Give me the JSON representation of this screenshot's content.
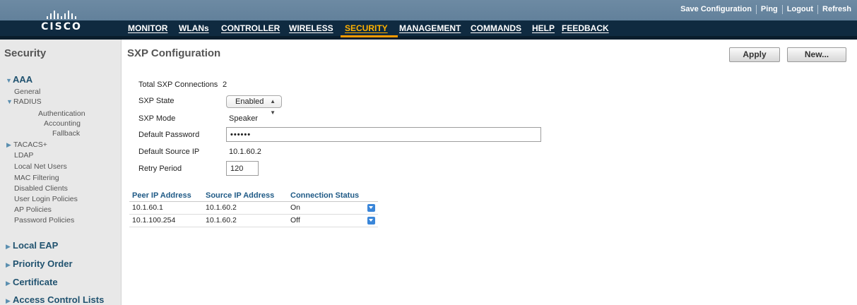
{
  "header": {
    "logo_text": "CISCO",
    "nav": [
      {
        "label": "MONITOR",
        "active": false
      },
      {
        "label": "WLANs",
        "active": false
      },
      {
        "label": "CONTROLLER",
        "active": false
      },
      {
        "label": "WIRELESS",
        "active": false
      },
      {
        "label": "SECURITY",
        "active": true
      },
      {
        "label": "MANAGEMENT",
        "active": false
      },
      {
        "label": "COMMANDS",
        "active": false
      },
      {
        "label": "HELP",
        "active": false
      },
      {
        "label": "FEEDBACK",
        "active": false
      }
    ],
    "utils": [
      "Save Configuration",
      "Ping",
      "Logout",
      "Refresh"
    ],
    "colors": {
      "active": "#ffb100",
      "bar": "#0f2a40"
    }
  },
  "sidebar": {
    "title": "Security",
    "aaa": {
      "label": "AAA",
      "general": "General",
      "radius": {
        "label": "RADIUS",
        "items": [
          "Authentication",
          "Accounting",
          "Fallback"
        ]
      },
      "items": [
        "TACACS+",
        "LDAP",
        "Local Net Users",
        "MAC Filtering",
        "Disabled Clients",
        "User Login Policies",
        "AP Policies",
        "Password Policies"
      ]
    },
    "groups": [
      "Local EAP",
      "Priority Order",
      "Certificate",
      "Access Control Lists"
    ]
  },
  "main": {
    "title": "SXP Configuration",
    "apply_label": "Apply",
    "new_label": "New...",
    "form": {
      "total_label": "Total SXP Connections",
      "total_value": "2",
      "state_label": "SXP State",
      "state_value": "Enabled",
      "mode_label": "SXP Mode",
      "mode_value": "Speaker",
      "password_label": "Default Password",
      "password_value": "••••••",
      "source_ip_label": "Default Source IP",
      "source_ip_value": "10.1.60.2",
      "retry_label": "Retry Period",
      "retry_value": "120"
    },
    "table": {
      "headers": [
        "Peer IP Address",
        "Source IP Address",
        "Connection Status"
      ],
      "rows": [
        {
          "peer": "10.1.60.1",
          "source": "10.1.60.2",
          "status": "On"
        },
        {
          "peer": "10.1.100.254",
          "source": "10.1.60.2",
          "status": "Off"
        }
      ]
    }
  }
}
